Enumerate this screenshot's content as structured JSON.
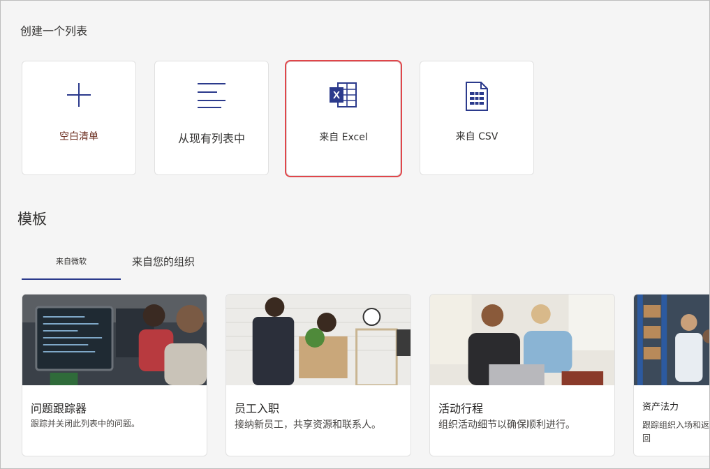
{
  "create": {
    "title": "创建一个列表",
    "cards": [
      {
        "label": "空白清单",
        "icon": "plus-icon"
      },
      {
        "label": "从现有列表中",
        "icon": "list-lines-icon"
      },
      {
        "label": "来自 Excel",
        "icon": "excel-icon"
      },
      {
        "label": "来自 CSV",
        "icon": "csv-document-icon"
      }
    ]
  },
  "templates": {
    "title": "模板",
    "tabs": [
      {
        "label": "来自微软",
        "selected": true
      },
      {
        "label": "来自您的组织",
        "selected": false
      }
    ],
    "cards": [
      {
        "title": "问题跟踪器",
        "description": "跟踪并关闭此列表中的问题。"
      },
      {
        "title": "员工入职",
        "description": "接纳新员工，共享资源和联系人。"
      },
      {
        "title": "活动行程",
        "description": "组织活动细节以确保顺利进行。"
      },
      {
        "title": "资产法力",
        "description": "跟踪组织入场和返回"
      }
    ]
  },
  "colors": {
    "accent": "#2b3a8c",
    "highlight": "#e0464a",
    "blank_label": "#6b2d1f"
  }
}
